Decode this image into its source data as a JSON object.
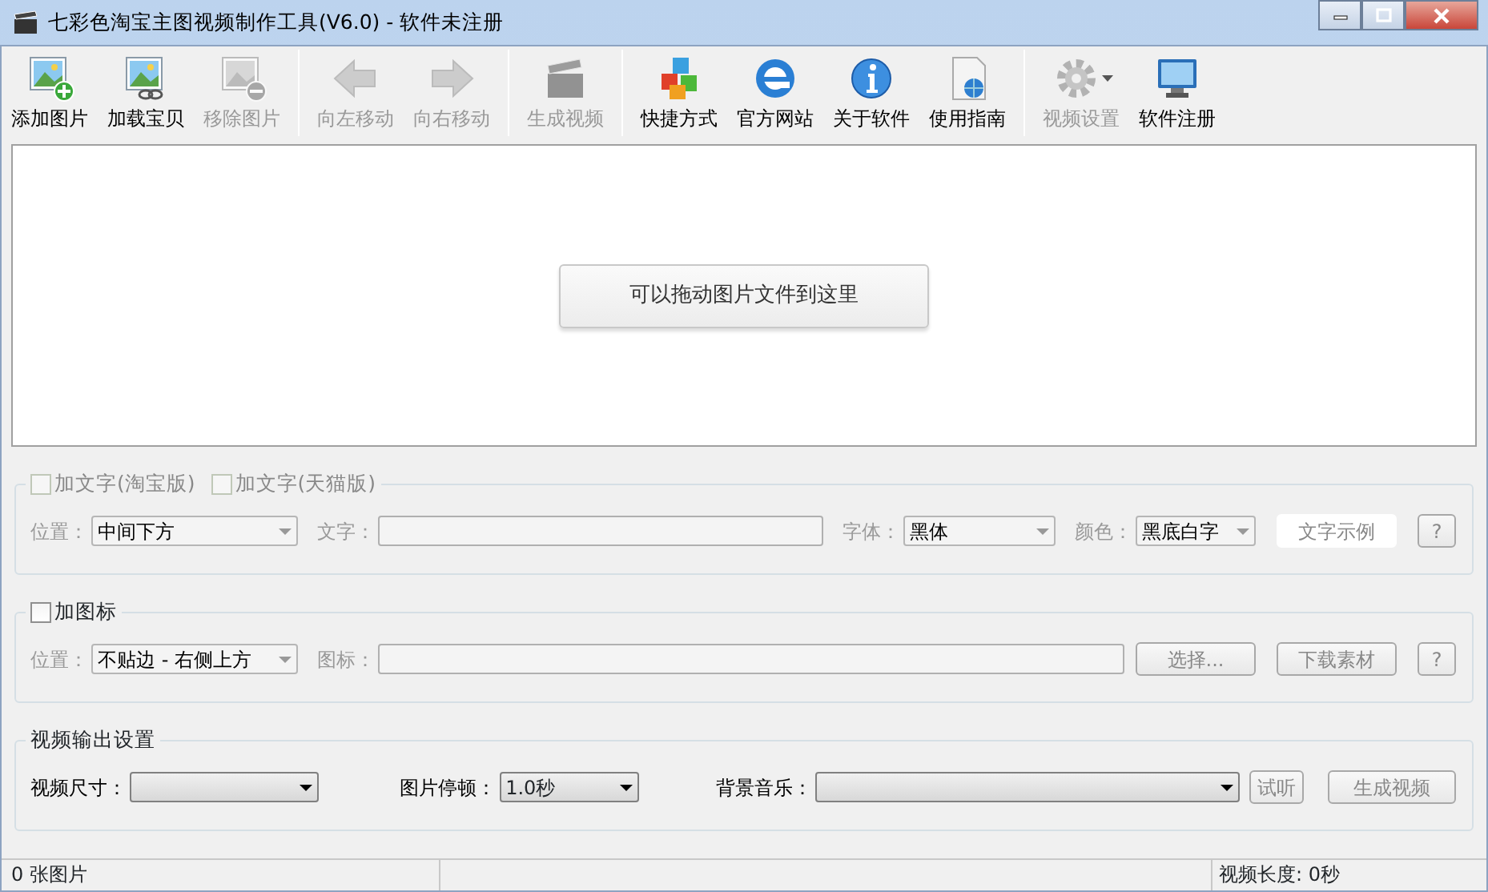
{
  "window": {
    "title": "七彩色淘宝主图视频制作工具(V6.0) - 软件未注册"
  },
  "toolbar": [
    {
      "label": "添加图片",
      "disabled": false
    },
    {
      "label": "加载宝贝",
      "disabled": false
    },
    {
      "label": "移除图片",
      "disabled": true
    },
    {
      "label": "向左移动",
      "disabled": true
    },
    {
      "label": "向右移动",
      "disabled": true
    },
    {
      "label": "生成视频",
      "disabled": true
    },
    {
      "label": "快捷方式",
      "disabled": false
    },
    {
      "label": "官方网站",
      "disabled": false
    },
    {
      "label": "关于软件",
      "disabled": false
    },
    {
      "label": "使用指南",
      "disabled": false
    },
    {
      "label": "视频设置",
      "disabled": true
    },
    {
      "label": "软件注册",
      "disabled": false
    }
  ],
  "drop_area": {
    "hint": "可以拖动图片文件到这里"
  },
  "groups": [
    {
      "legend": [
        {
          "kind": "checkbox",
          "label": "加文字(淘宝版)",
          "checked": false,
          "disabled": true
        },
        {
          "kind": "checkbox",
          "label": "加文字(天猫版)",
          "checked": false,
          "disabled": true
        }
      ],
      "fields": [
        {
          "kind": "select",
          "label": "位置：",
          "value": "中间下方",
          "disabled": true
        },
        {
          "kind": "input",
          "label": "文字：",
          "disabled": true
        },
        {
          "kind": "select",
          "label": "字体：",
          "value": "黑体",
          "disabled": true
        },
        {
          "kind": "select",
          "label": "颜色：",
          "value": "黑底白字",
          "disabled": true
        },
        {
          "kind": "flat-button",
          "value": "文字示例",
          "disabled": true
        },
        {
          "kind": "button",
          "value": "?",
          "disabled": true
        }
      ]
    },
    {
      "legend": [
        {
          "kind": "checkbox",
          "label": "加图标",
          "checked": false,
          "disabled": false
        }
      ],
      "fields": [
        {
          "kind": "select",
          "label": "位置：",
          "value": "不贴边 - 右侧上方",
          "disabled": true
        },
        {
          "kind": "input",
          "label": "图标：",
          "disabled": true
        },
        {
          "kind": "button",
          "value": "选择...",
          "disabled": true
        },
        {
          "kind": "button",
          "value": "下载素材",
          "disabled": true
        },
        {
          "kind": "button",
          "value": "?",
          "disabled": true
        }
      ]
    },
    {
      "legend": [
        {
          "kind": "text",
          "label": "视频输出设置"
        }
      ],
      "fields": [
        {
          "kind": "select",
          "label": "视频尺寸：",
          "disabled": false
        },
        {
          "kind": "select",
          "label": "图片停顿：",
          "value": "1.0秒",
          "disabled": false
        },
        {
          "kind": "select",
          "label": "背景音乐：",
          "disabled": false
        },
        {
          "kind": "button",
          "value": "试听",
          "disabled": true
        },
        {
          "kind": "button",
          "value": "生成视频",
          "disabled": true
        }
      ]
    }
  ],
  "status_bar": {
    "left": "0 张图片",
    "right": "视频长度: 0秒"
  }
}
